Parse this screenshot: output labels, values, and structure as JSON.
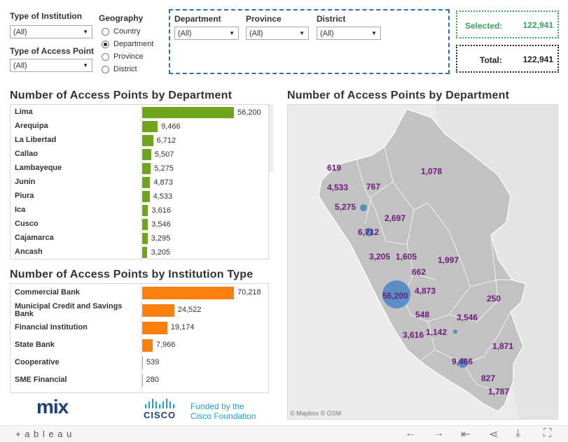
{
  "filters": {
    "type_of_institution": {
      "label": "Type of Institution",
      "value": "(All)"
    },
    "type_of_access_point": {
      "label": "Type of Access Point",
      "value": "(All)"
    },
    "geography": {
      "label": "Geography",
      "options": [
        "Country",
        "Department",
        "Province",
        "District"
      ],
      "selected": "Department"
    },
    "department": {
      "label": "Department",
      "value": "(All)"
    },
    "province": {
      "label": "Province",
      "value": "(All)"
    },
    "district": {
      "label": "District",
      "value": "(All)"
    }
  },
  "summary": {
    "selected_label": "Selected:",
    "selected_value": "122,941",
    "total_label": "Total:",
    "total_value": "122,941"
  },
  "dept_chart_title": "Number of Access Points by Department",
  "inst_chart_title": "Number of Access Points by Institution Type",
  "map_title": "Number of Access Points by Department",
  "map_attribution": "© Mapbox  © OSM",
  "colors": {
    "green": "#6fa51d",
    "orange": "#ff7f0e",
    "blue": "#3d7fc1",
    "label_purple": "#6d1a7a"
  },
  "chart_data": [
    {
      "type": "bar",
      "orientation": "horizontal",
      "title": "Number of Access Points by Department",
      "categories": [
        "Lima",
        "Arequipa",
        "La Libertad",
        "Callao",
        "Lambayeque",
        "Junin",
        "Piura",
        "Ica",
        "Cusco",
        "Cajamarca",
        "Ancash"
      ],
      "values": [
        56200,
        9466,
        6712,
        5507,
        5275,
        4873,
        4533,
        3616,
        3546,
        3295,
        3205
      ],
      "value_labels": [
        "56,200",
        "9,466",
        "6,712",
        "5,507",
        "5,275",
        "4,873",
        "4,533",
        "3,616",
        "3,546",
        "3,295",
        "3,205"
      ],
      "xlim": [
        0,
        56200
      ]
    },
    {
      "type": "bar",
      "orientation": "horizontal",
      "title": "Number of Access Points by Institution Type",
      "categories": [
        "Commercial Bank",
        "Municipal Credit and Savings Bank",
        "Financial Institution",
        "State Bank",
        "Cooperative",
        "SME Financial"
      ],
      "values": [
        70218,
        24522,
        19174,
        7966,
        539,
        280
      ],
      "value_labels": [
        "70,218",
        "24,522",
        "19,174",
        "7,966",
        "539",
        "280"
      ],
      "xlim": [
        0,
        70218
      ]
    }
  ],
  "map_labels": [
    "619",
    "1,078",
    "4,533",
    "767",
    "5,275",
    "2,697",
    "6,712",
    "3,205",
    "1,605",
    "1,997",
    "662",
    "56,200",
    "4,873",
    "250",
    "548",
    "3,546",
    "1,142",
    "3,616",
    "1,871",
    "9,466",
    "827",
    "1,787"
  ],
  "logos": {
    "mix": "mix",
    "cisco": "CISCO",
    "funded_line1": "Funded by the",
    "funded_line2": "Cisco Foundation"
  },
  "footer": {
    "brand": "+ a b l e a u"
  }
}
